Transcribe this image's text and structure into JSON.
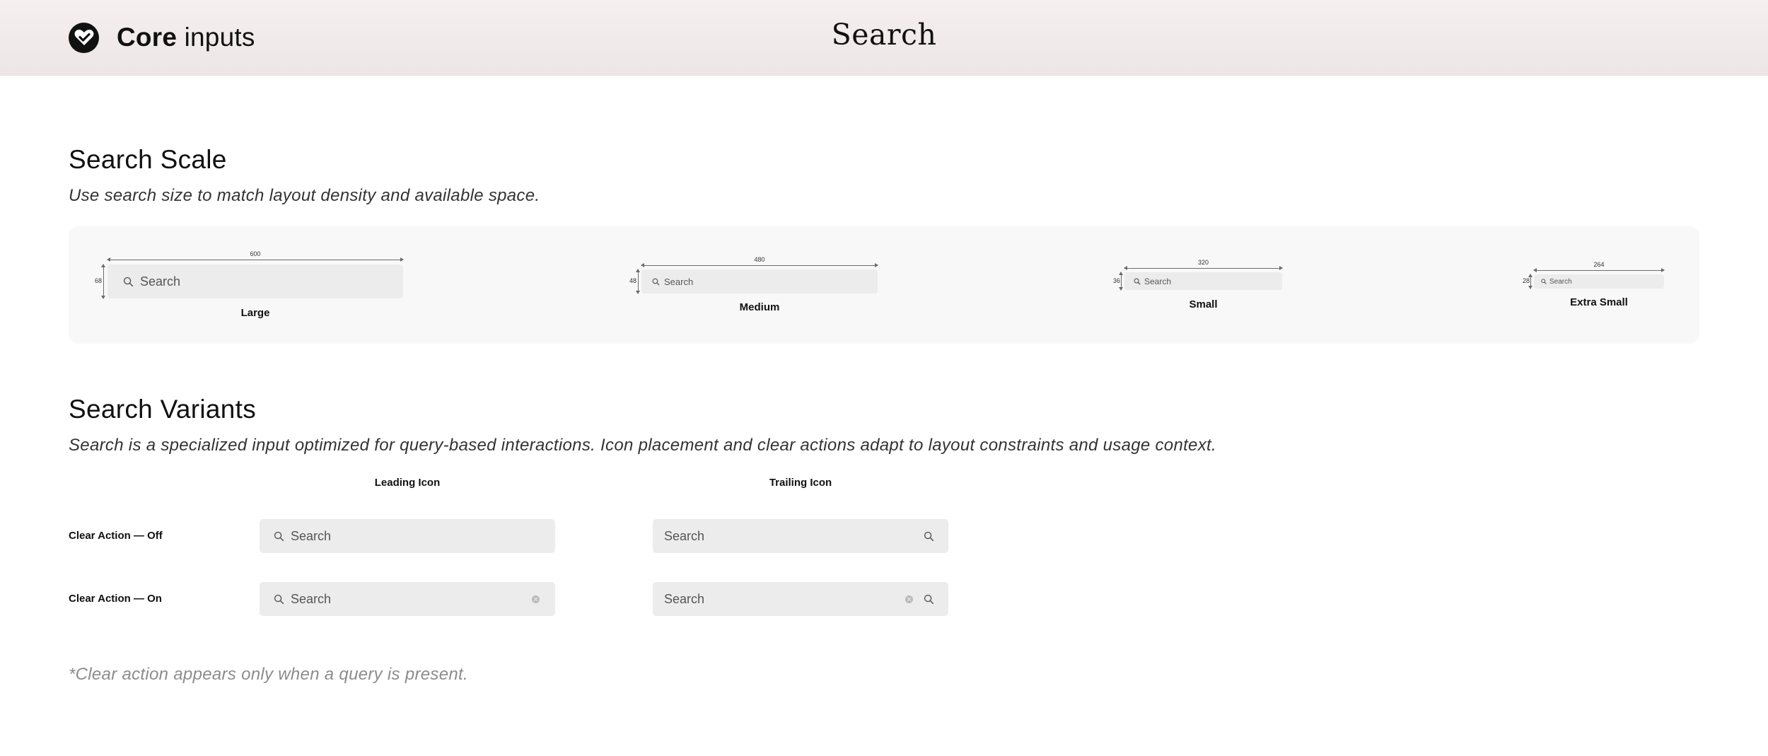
{
  "header": {
    "brand_bold": "Core",
    "brand_light": "inputs",
    "title": "Search",
    "logo_icon": "heart-check-icon"
  },
  "scale": {
    "title": "Search Scale",
    "description": "Use search size to match layout density and available space.",
    "items": [
      {
        "caption": "Large",
        "width_label": "600",
        "height_label": "68",
        "placeholder": "Search"
      },
      {
        "caption": "Medium",
        "width_label": "480",
        "height_label": "48",
        "placeholder": "Search"
      },
      {
        "caption": "Small",
        "width_label": "320",
        "height_label": "36",
        "placeholder": "Search"
      },
      {
        "caption": "Extra Small",
        "width_label": "264",
        "height_label": "28",
        "placeholder": "Search"
      }
    ]
  },
  "variants": {
    "title": "Search Variants",
    "description": "Search is a specialized input optimized for query-based interactions. Icon placement and clear actions adapt to layout constraints and usage context.",
    "columns": [
      "Leading Icon",
      "Trailing Icon"
    ],
    "rows": [
      "Clear Action — Off",
      "Clear Action — On"
    ],
    "placeholder": "Search",
    "footnote": "*Clear action appears only when a query is present."
  },
  "colors": {
    "header_bg": "#f2ecec",
    "panel_bg": "#f8f8f8",
    "input_bg": "#ececec",
    "text_primary": "#111111",
    "text_muted": "#8c8c8c"
  }
}
